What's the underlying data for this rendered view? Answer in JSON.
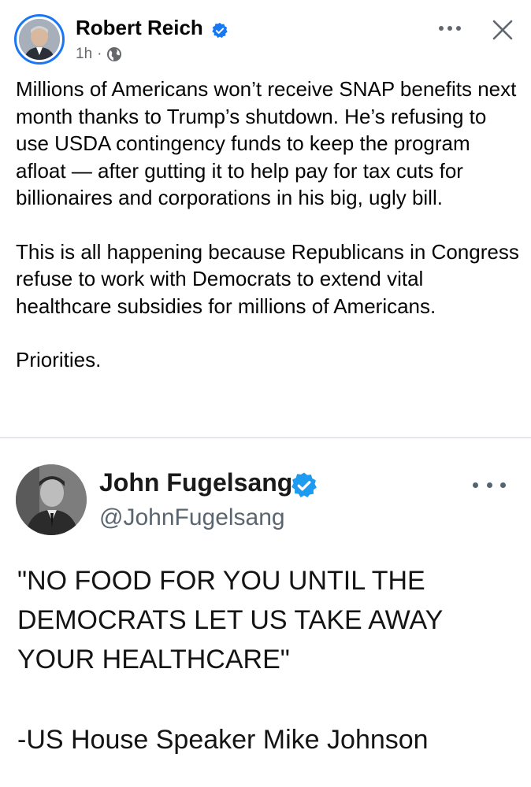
{
  "post": {
    "author": "Robert Reich",
    "time": "1h",
    "separator": "·",
    "paragraphs": [
      "Millions of Americans won’t receive SNAP benefits next month thanks to Trump’s shutdown. He’s refusing to use USDA contingency funds to keep the program afloat — after gutting it to help pay for tax cuts for billionaires and corporations in his big, ugly bill.",
      "This is all happening because Republicans in Congress refuse to work with Democrats to extend vital healthcare subsidies for millions of Americans.",
      "Priorities."
    ]
  },
  "shared_image": {
    "name": "John Fugelsang",
    "handle": "@JohnFugelsang",
    "quote": "\"NO FOOD FOR YOU UNTIL THE DEMOCRATS LET US TAKE AWAY YOUR HEALTHCARE\"",
    "attribution": "-US House Speaker Mike Johnson"
  },
  "icons": {
    "verified": "verified-badge-icon",
    "globe": "globe-icon",
    "more": "more-options-icon",
    "close": "close-icon"
  },
  "colors": {
    "accent": "#1877f2",
    "meta_text": "#65676b",
    "twitter_verified": "#1d9bf0"
  }
}
